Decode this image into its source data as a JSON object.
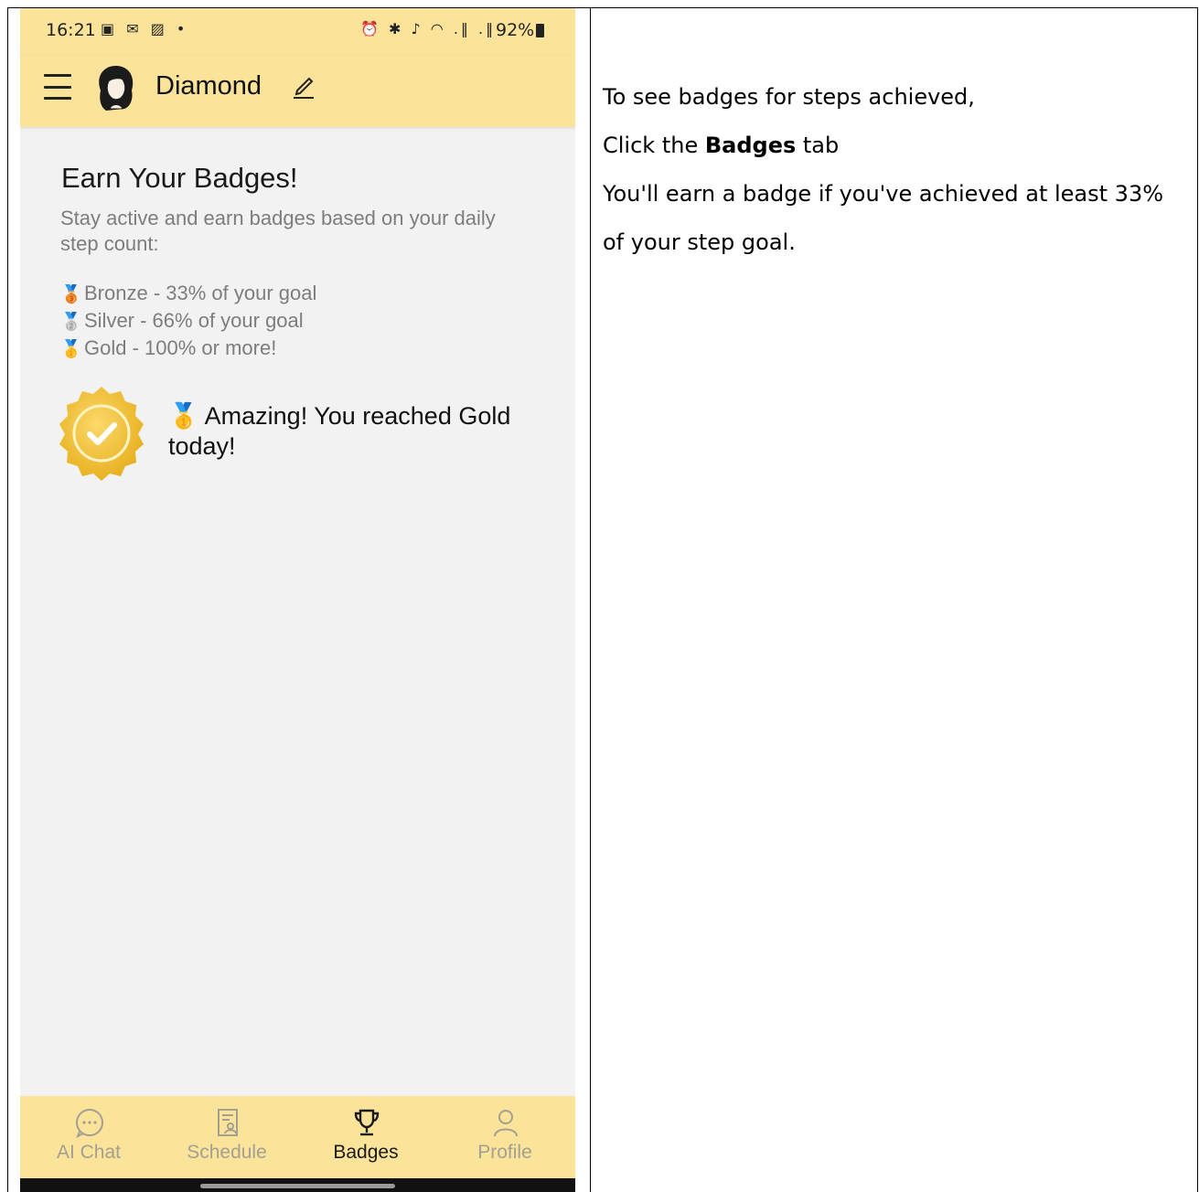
{
  "status_bar": {
    "time": "16:21",
    "left_icons": "▣ ✉ ▨ •",
    "right_icons": "⏰ ✱ ♪ ◠ .‖ .‖",
    "battery": "92%"
  },
  "header": {
    "user_name": "Diamond"
  },
  "badges": {
    "heading": "Earn Your Badges!",
    "intro": "Stay active and earn badges based on your daily step count:",
    "tiers": [
      {
        "medal": "🥉",
        "label": "Bronze - 33% of your goal"
      },
      {
        "medal": "🥈",
        "label": "Silver - 66% of your goal"
      },
      {
        "medal": "🥇",
        "label": "Gold - 100% or more!"
      }
    ],
    "achievement_medal": "🥇",
    "achievement": "Amazing! You reached Gold today!"
  },
  "nav": {
    "items": [
      {
        "label": "AI Chat",
        "icon": "chat-bubble-icon",
        "active": false
      },
      {
        "label": "Schedule",
        "icon": "schedule-document-icon",
        "active": false
      },
      {
        "label": "Badges",
        "icon": "trophy-icon",
        "active": true
      },
      {
        "label": "Profile",
        "icon": "person-icon",
        "active": false
      }
    ]
  },
  "instructions": {
    "line1": "To see badges for steps achieved,",
    "line2_prefix": "Click the ",
    "line2_bold": "Badges",
    "line2_suffix": " tab",
    "line3": "You'll earn a badge if you've achieved at least 33%",
    "line4": "of your step goal."
  },
  "colors": {
    "header_yellow": "#fbe49a",
    "background": "#f2f2f2",
    "badge_gold": "#f2c230"
  }
}
